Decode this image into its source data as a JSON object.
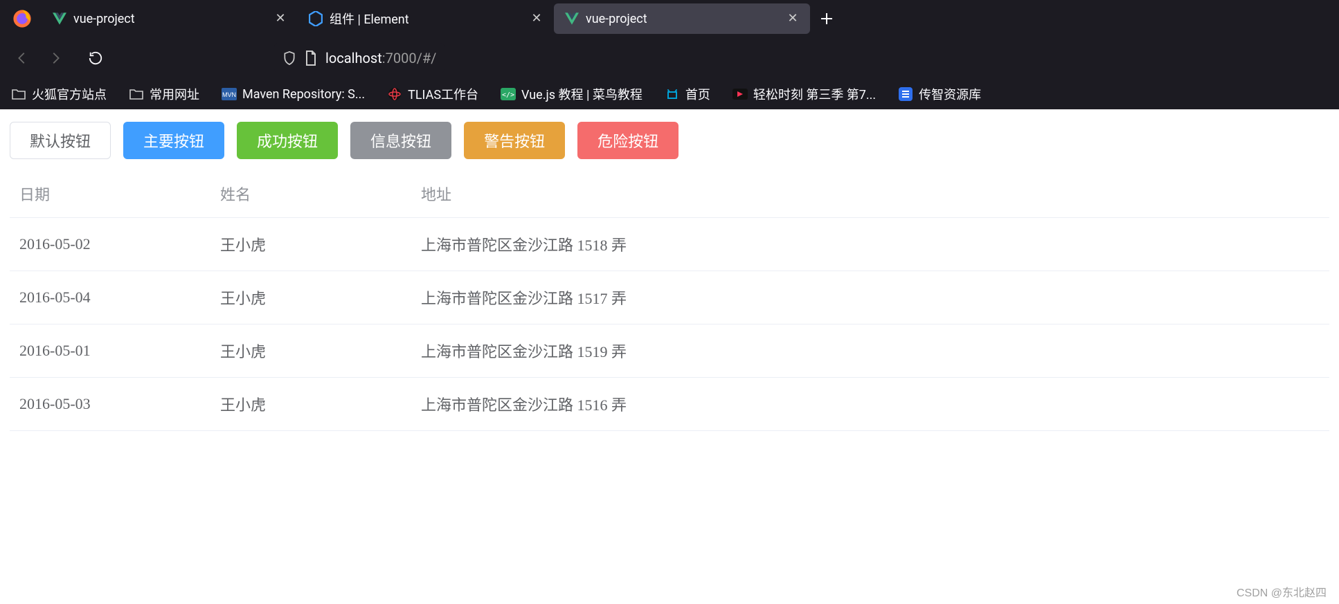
{
  "browser": {
    "tabs": [
      {
        "label": "vue-project",
        "favicon": "vue",
        "active": false
      },
      {
        "label": "组件 | Element",
        "favicon": "element",
        "active": false
      },
      {
        "label": "vue-project",
        "favicon": "vue",
        "active": true
      }
    ],
    "url": {
      "host": "localhost",
      "path": ":7000/#/"
    },
    "bookmarks": [
      {
        "label": "火狐官方站点",
        "icon": "folder"
      },
      {
        "label": "常用网址",
        "icon": "folder"
      },
      {
        "label": "Maven Repository: S...",
        "icon": "mvn"
      },
      {
        "label": "TLIAS工作台",
        "icon": "tlias"
      },
      {
        "label": "Vue.js 教程 | 菜鸟教程",
        "icon": "runoob"
      },
      {
        "label": "首页",
        "icon": "bili"
      },
      {
        "label": "轻松时刻 第三季 第7...",
        "icon": "youku"
      },
      {
        "label": "传智资源库",
        "icon": "cz"
      }
    ]
  },
  "buttons": [
    {
      "label": "默认按钮",
      "variant": "default"
    },
    {
      "label": "主要按钮",
      "variant": "primary"
    },
    {
      "label": "成功按钮",
      "variant": "success"
    },
    {
      "label": "信息按钮",
      "variant": "info"
    },
    {
      "label": "警告按钮",
      "variant": "warning"
    },
    {
      "label": "危险按钮",
      "variant": "danger"
    }
  ],
  "table": {
    "headers": {
      "date": "日期",
      "name": "姓名",
      "address": "地址"
    },
    "rows": [
      {
        "date": "2016-05-02",
        "name": "王小虎",
        "address": "上海市普陀区金沙江路 1518 弄"
      },
      {
        "date": "2016-05-04",
        "name": "王小虎",
        "address": "上海市普陀区金沙江路 1517 弄"
      },
      {
        "date": "2016-05-01",
        "name": "王小虎",
        "address": "上海市普陀区金沙江路 1519 弄"
      },
      {
        "date": "2016-05-03",
        "name": "王小虎",
        "address": "上海市普陀区金沙江路 1516 弄"
      }
    ]
  },
  "watermark": "CSDN @东北赵四"
}
